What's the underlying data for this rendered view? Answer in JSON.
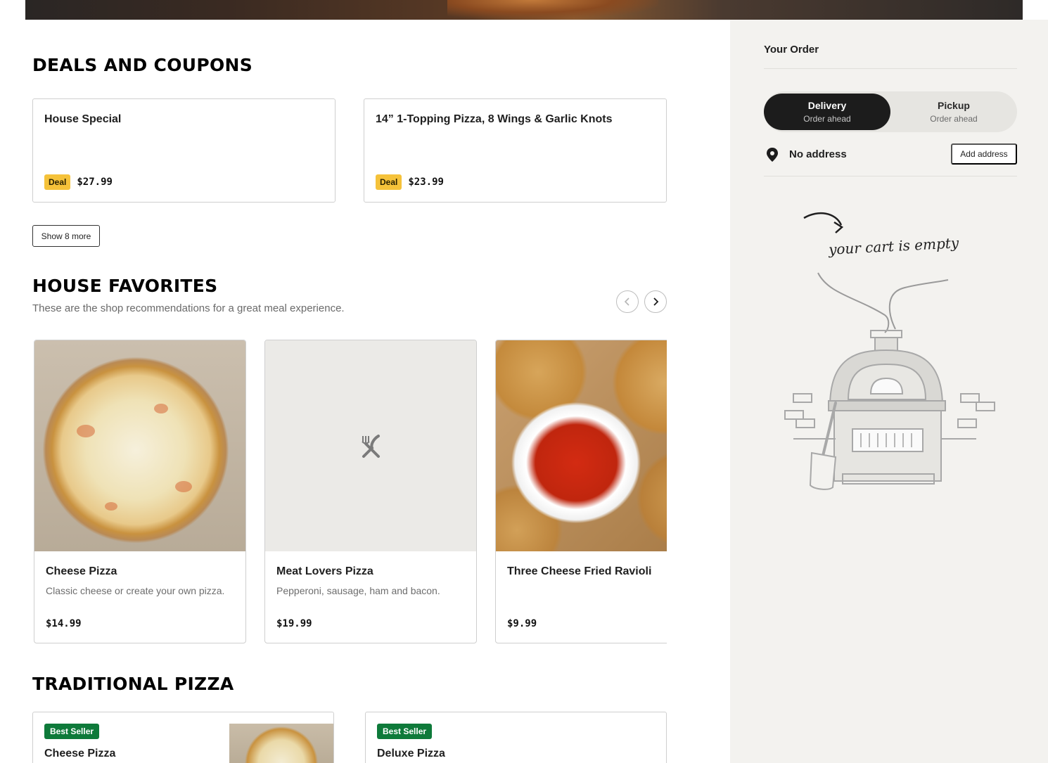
{
  "deals": {
    "title": "DEALS AND COUPONS",
    "items": [
      {
        "name": "House Special",
        "badge": "Deal",
        "price": "$27.99"
      },
      {
        "name": "14” 1-Topping Pizza, 8 Wings & Garlic Knots",
        "badge": "Deal",
        "price": "$23.99"
      }
    ],
    "show_more_label": "Show 8 more"
  },
  "favorites": {
    "title": "HOUSE FAVORITES",
    "subtitle": "These are the shop recommendations for a great meal experience.",
    "items": [
      {
        "name": "Cheese Pizza",
        "description": "Classic cheese or create your own pizza.",
        "price": "$14.99",
        "image": "cheese-pizza-photo"
      },
      {
        "name": "Meat Lovers Pizza",
        "description": "Pepperoni, sausage, ham and bacon.",
        "price": "$19.99",
        "image": "utensils-placeholder-icon"
      },
      {
        "name": "Three Cheese Fried Ravioli",
        "description": "",
        "price": "$9.99",
        "image": "fried-ravioli-photo"
      }
    ]
  },
  "traditional": {
    "title": "TRADITIONAL PIZZA",
    "items": [
      {
        "badge": "Best Seller",
        "name": "Cheese Pizza"
      },
      {
        "badge": "Best Seller",
        "name": "Deluxe Pizza"
      }
    ]
  },
  "order": {
    "title": "Your Order",
    "modes": [
      {
        "label": "Delivery",
        "sub": "Order ahead",
        "active": true
      },
      {
        "label": "Pickup",
        "sub": "Order ahead",
        "active": false
      }
    ],
    "address_text": "No address",
    "add_address_label": "Add address",
    "empty_message": "your cart is empty"
  },
  "colors": {
    "deal_badge": "#f5c23a",
    "best_seller_badge": "#0e7a3a",
    "sidebar_bg": "#f3f2ef",
    "toggle_active": "#1c1c1c"
  }
}
